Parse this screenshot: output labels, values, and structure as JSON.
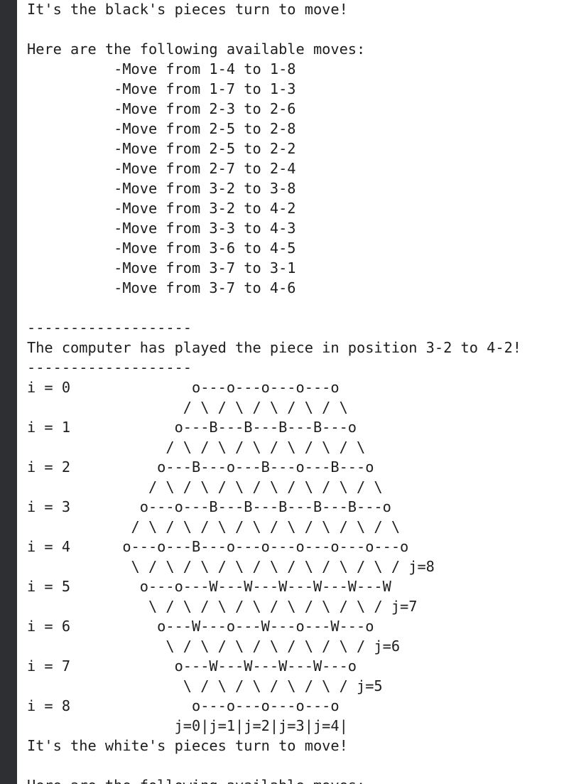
{
  "terminal": {
    "lines": [
      "It's the black's pieces turn to move!",
      "",
      "Here are the following available moves:",
      "          -Move from 1-4 to 1-8",
      "          -Move from 1-7 to 1-3",
      "          -Move from 2-3 to 2-6",
      "          -Move from 2-5 to 2-8",
      "          -Move from 2-5 to 2-2",
      "          -Move from 2-7 to 2-4",
      "          -Move from 3-2 to 3-8",
      "          -Move from 3-2 to 4-2",
      "          -Move from 3-3 to 4-3",
      "          -Move from 3-6 to 4-5",
      "          -Move from 3-7 to 3-1",
      "          -Move from 3-7 to 4-6",
      "",
      "-------------------",
      "The computer has played the piece in position 3-2 to 4-2!",
      "-------------------",
      "i = 0              o---o---o---o---o",
      "                  / \\ / \\ / \\ / \\ / \\",
      "i = 1            o---B---B---B---B---o",
      "                / \\ / \\ / \\ / \\ / \\ / \\",
      "i = 2          o---B---o---B---o---B---o",
      "              / \\ / \\ / \\ / \\ / \\ / \\ / \\",
      "i = 3        o---o---B---B---B---B---B---o",
      "            / \\ / \\ / \\ / \\ / \\ / \\ / \\ / \\",
      "i = 4      o---o---B---o---o---o---o---o---o",
      "            \\ / \\ / \\ / \\ / \\ / \\ / \\ / \\ / j=8",
      "i = 5        o---o---W---W---W---W---W---W",
      "              \\ / \\ / \\ / \\ / \\ / \\ / \\ / j=7",
      "i = 6          o---W---o---W---o---W---o",
      "                \\ / \\ / \\ / \\ / \\ / \\ / j=6",
      "i = 7            o---W---W---W---W---o",
      "                  \\ / \\ / \\ / \\ / \\ / j=5",
      "i = 8              o---o---o---o---o",
      "                 j=0|j=1|j=2|j=3|j=4|",
      "It's the white's pieces turn to move!",
      "",
      "Here are the following available moves:"
    ]
  }
}
